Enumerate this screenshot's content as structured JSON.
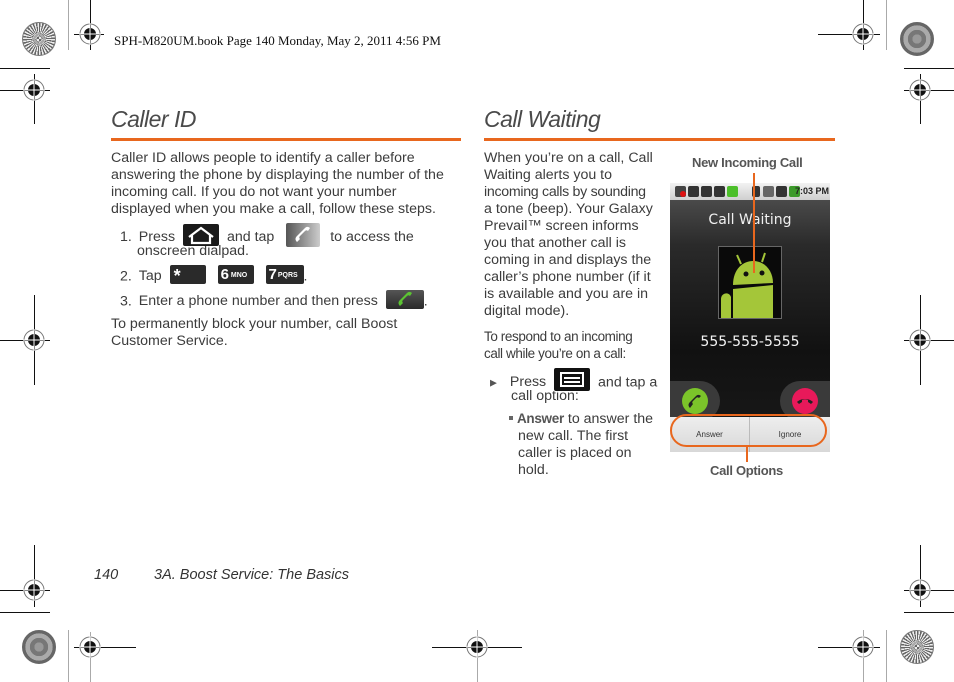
{
  "slug_line": "SPH-M820UM.book  Page 140  Monday, May 2, 2011  4:56 PM",
  "caller_id": {
    "heading": "Caller ID",
    "intro": [
      "Caller ID allows people to identify a caller before",
      "answering the phone by displaying the number of the",
      "incoming call. If you do not want your number",
      "displayed when you make a call, follow these steps."
    ],
    "steps": [
      {
        "num": "1.",
        "text_a": "Press",
        "icon_a": "home-key-icon",
        "text_b": "and tap",
        "icon_b": "phone-app-icon",
        "text_c": "to access the",
        "text_d": "onscreen dialpad."
      },
      {
        "num": "2.",
        "text_a": "Tap",
        "keys": [
          "*",
          "6 MNO",
          "7 PQRS"
        ],
        "text_end": "."
      },
      {
        "num": "3.",
        "text_a": "Enter a phone number and then press",
        "icon_a": "call-key-icon",
        "text_end": "."
      }
    ],
    "outro": [
      "To permanently block your number, call Boost",
      "Customer Service."
    ],
    "key_labels": {
      "star": "*",
      "six_digit": "6",
      "six_letters": "MNO",
      "seven_digit": "7",
      "seven_letters": "PQRS"
    }
  },
  "call_waiting": {
    "heading": "Call Waiting",
    "intro": [
      "When you’re on a call, Call",
      "Waiting alerts you to",
      "incoming calls by sounding",
      "a tone (beep). Your Galaxy",
      "Prevail™ screen informs",
      "you that another call is",
      "coming in and displays the",
      "caller’s phone number (if it",
      "is available and you are in",
      "digital mode)."
    ],
    "respond": [
      "To respond to an incoming",
      "call while you’re on a call:"
    ],
    "bullet_press": "Press",
    "bullet_after": "and tap a",
    "bullet_line2": "call option:",
    "sub_bold": "Answer",
    "sub_rest": [
      "to answer the",
      "new call. The first",
      "caller is placed on",
      "hold."
    ]
  },
  "phone_screen": {
    "callout_top": "New Incoming Call",
    "callout_bottom": "Call Options",
    "status_time": "7:03 PM",
    "title": "Call Waiting",
    "number": "555-555-5555",
    "answer_label": "Answer",
    "ignore_label": "Ignore"
  },
  "footer": {
    "page_number": "140",
    "section": "3A. Boost Service: The Basics"
  },
  "colors": {
    "accent": "#e8671e",
    "android_green": "#a4c639",
    "answer_green": "#7bc42a",
    "ignore_red": "#e8195a"
  }
}
